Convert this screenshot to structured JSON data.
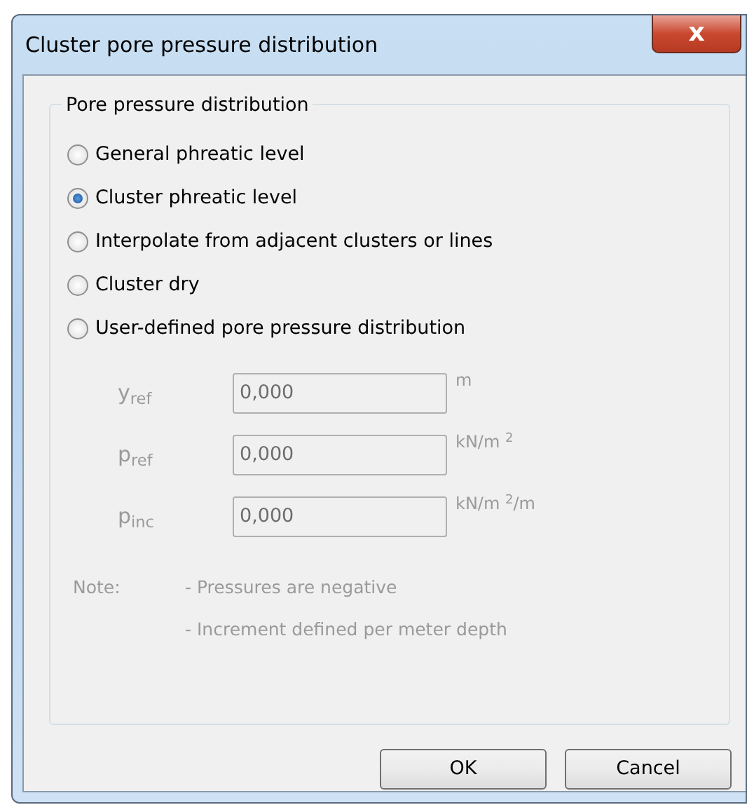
{
  "window": {
    "title": "Cluster pore pressure distribution",
    "close": "x"
  },
  "group": {
    "title": "Pore pressure distribution",
    "options": [
      {
        "label": "General phreatic level",
        "selected": false
      },
      {
        "label": "Cluster phreatic level",
        "selected": true
      },
      {
        "label": "Interpolate from adjacent clusters or lines",
        "selected": false
      },
      {
        "label": "Cluster dry",
        "selected": false
      },
      {
        "label": "User-defined pore pressure distribution",
        "selected": false
      }
    ],
    "fields": [
      {
        "label": "y$_{ref}$",
        "value": "0,000",
        "unit": "m",
        "disabled": true
      },
      {
        "label": "p$_{ref}$",
        "value": "0,000",
        "unit": "kN/m $^{2}$",
        "disabled": true
      },
      {
        "label": "p$_{inc}$",
        "value": "0,000",
        "unit": "kN/m $^{2}$/m",
        "disabled": true
      }
    ],
    "note": {
      "label": "Note:",
      "lines": [
        "- Pressures are negative",
        "- Increment defined per meter depth"
      ],
      "disabled": true
    }
  },
  "buttons": [
    "OK",
    "Cancel"
  ]
}
